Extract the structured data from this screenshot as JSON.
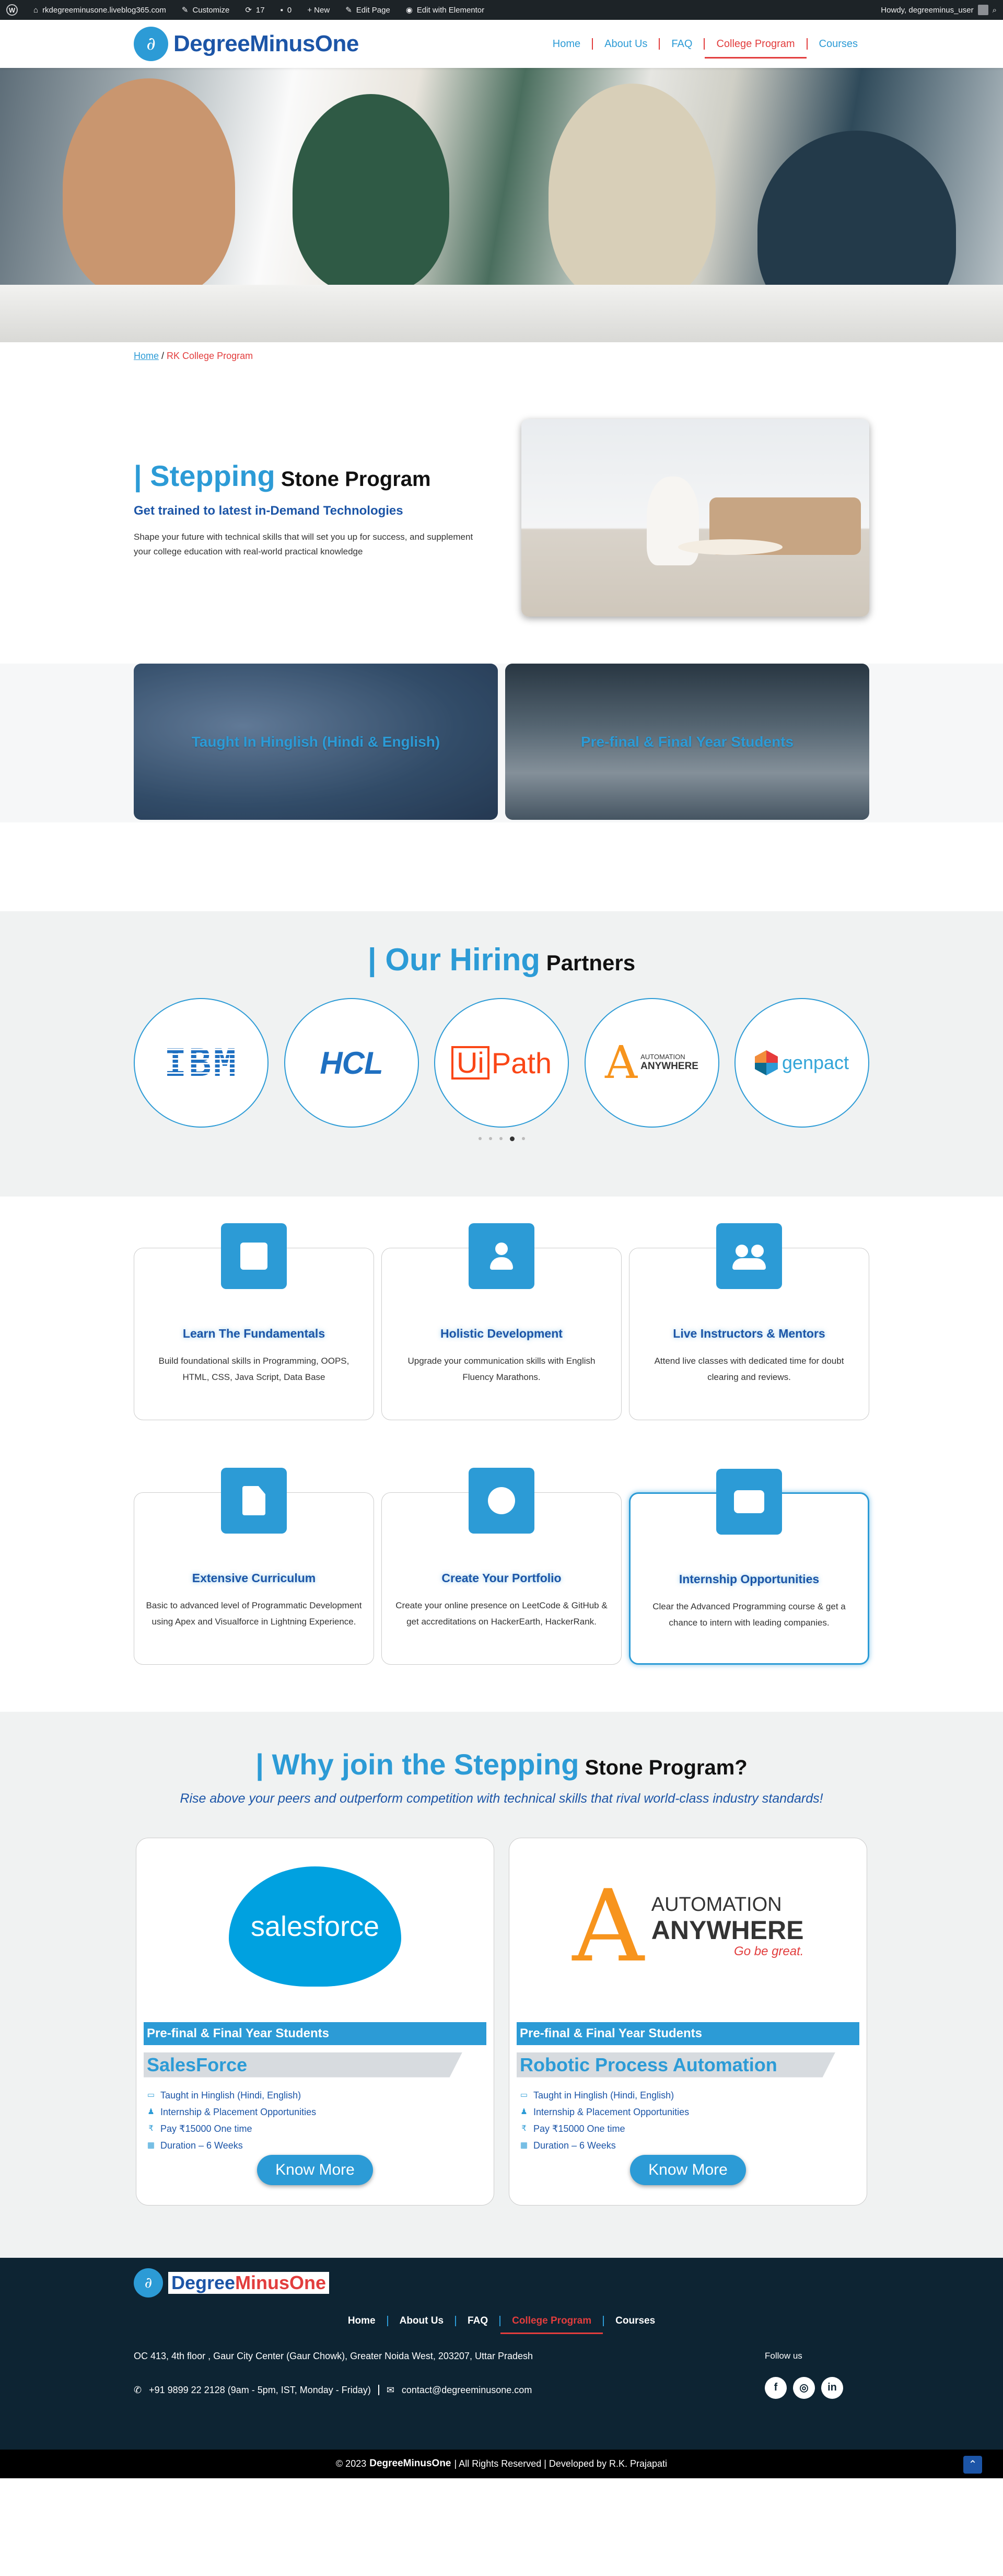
{
  "adminbar": {
    "site": "rkdegreeminusone.liveblog365.com",
    "customize": "Customize",
    "updates": "17",
    "comments": "0",
    "new": "+ New",
    "edit_page": "Edit Page",
    "elementor": "Edit with Elementor",
    "howdy": "Howdy, degreeminus_user"
  },
  "header": {
    "logo_part1": "Degree",
    "logo_part2": "MinusOne",
    "nav": [
      "Home",
      "About Us",
      "FAQ",
      "College Program",
      "Courses"
    ],
    "active": "College Program"
  },
  "breadcrumb": {
    "home": "Home",
    "sep": " / ",
    "current": "RK College Program"
  },
  "intro": {
    "bar": "| ",
    "title_blue": "Stepping",
    "title_dark": " Stone Program",
    "subtitle": "Get trained to latest in-Demand Technologies",
    "text": "Shape your future with technical skills that will set you up for success, and supplement your college education with real-world practical knowledge"
  },
  "promo_cards": [
    "Taught In Hinglish (Hindi & English)",
    "Pre-final & Final Year Students"
  ],
  "partners": {
    "bar": "| ",
    "title_blue": "Our Hiring",
    "title_dark": " Partners",
    "logos": [
      "IBM",
      "HCL",
      "UiPath",
      "AUTOMATION ANYWHERE",
      "genpact"
    ],
    "uipath_box": "Ui",
    "uipath_rest": "Path",
    "aa_top": "AUTOMATION",
    "aa_bottom": "ANYWHERE",
    "dots_count": 5,
    "active_dot": 4
  },
  "features": [
    {
      "title": "Learn The Fundamentals",
      "text": "Build foundational skills in Programming, OOPS, HTML, CSS, Java Script, Data Base",
      "icon": "book-icon"
    },
    {
      "title": "Holistic Development",
      "text": "Upgrade your communication skills with English Fluency Marathons.",
      "icon": "user-icon"
    },
    {
      "title": "Live Instructors & Mentors",
      "text": "Attend live classes with dedicated time for doubt clearing and reviews.",
      "icon": "users-icon"
    },
    {
      "title": "Extensive Curriculum",
      "text": "Basic to advanced level of Programmatic Development using Apex and Visualforce in Lightning Experience.",
      "icon": "file-icon"
    },
    {
      "title": "Create Your Portfolio",
      "text": "Create your online presence on LeetCode & GitHub & get accreditations on HackerEarth, HackerRank.",
      "icon": "globe-icon"
    },
    {
      "title": "Internship Opportunities",
      "text": "Clear the Advanced Programming course & get a chance to intern with leading companies.",
      "icon": "briefcase-icon"
    }
  ],
  "why": {
    "bar": "| ",
    "title_blue": "Why join the Stepping",
    "title_dark": " Stone Program?",
    "tagline": "Rise above your peers and outperform competition with technical skills that rival world-class industry standards!"
  },
  "courses": [
    {
      "logo": "salesforce",
      "ribbon": "Pre-final & Final Year Students",
      "title": "SalesForce",
      "points": [
        "Taught in Hinglish (Hindi, English)",
        "Internship & Placement Opportunities",
        "Pay ₹15000 One time",
        "Duration – 6 Weeks"
      ],
      "button": "Know More"
    },
    {
      "logo": "AUTOMATION ANYWHERE",
      "logo_tag": "Go be great.",
      "ribbon": "Pre-final & Final Year Students",
      "title": "Robotic Process Automation",
      "points": [
        "Taught in Hinglish (Hindi, English)",
        "Internship & Placement Opportunities",
        "Pay ₹15000 One time",
        "Duration – 6 Weeks"
      ],
      "button": "Know More"
    }
  ],
  "footer": {
    "logo_part1": "Degree",
    "logo_part2": "MinusOne",
    "nav": [
      "Home",
      "About Us",
      "FAQ",
      "College Program",
      "Courses"
    ],
    "address": "OC 413, 4th floor , Gaur City Center (Gaur Chowk), Greater Noida West, 203207, Uttar Pradesh",
    "phone": "+91 9899 22 2128 (9am - 5pm, IST, Monday - Friday)",
    "email": "contact@degreeminusone.com",
    "follow": "Follow us",
    "social": [
      "f",
      "◎",
      "in"
    ],
    "copyright_pre": "© 2023 ",
    "copyright_brand": "DegreeMinusOne",
    "copyright_post": " | All Rights Reserved | Developed by R.K. Prajapati"
  },
  "colors": {
    "primary": "#2c9bd6",
    "navy": "#1c55a7",
    "accent_red": "#e23d3d",
    "footer": "#0d2433"
  }
}
